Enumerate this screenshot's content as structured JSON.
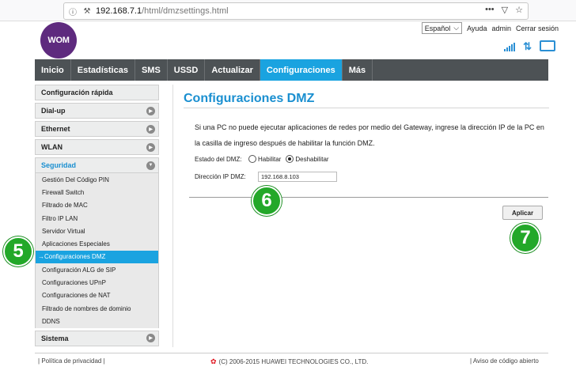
{
  "browser": {
    "url_host": "192.168.7.1",
    "url_path": "/html/dmzsettings.html",
    "menu_glyph": "•••"
  },
  "header": {
    "logo_text": "WOM",
    "language": "Español",
    "help": "Ayuda",
    "user": "admin",
    "logout": "Cerrar sesión"
  },
  "nav": {
    "items": [
      "Inicio",
      "Estadísticas",
      "SMS",
      "USSD",
      "Actualizar",
      "Configuraciones",
      "Más"
    ],
    "active_index": 5
  },
  "sidebar": {
    "quick": "Configuración rápida",
    "dialup": "Dial-up",
    "ethernet": "Ethernet",
    "wlan": "WLAN",
    "security": "Seguridad",
    "security_items": [
      "Gestión Del Código PIN",
      "Firewall Switch",
      "Filtrado de MAC",
      "Filtro IP LAN",
      "Servidor Virtual",
      "Aplicaciones Especiales",
      "→Configuraciones DMZ",
      "Configuración ALG de SIP",
      "Configuraciones UPnP",
      "Configuraciones de NAT",
      "Filtrado de nombres de dominio",
      "DDNS"
    ],
    "system": "Sistema"
  },
  "main": {
    "title": "Configuraciones DMZ",
    "description": "Si una PC no puede ejecutar aplicaciones de redes por medio del Gateway, ingrese la dirección IP de la PC en la casilla de ingreso después de habilitar la función DMZ.",
    "dmz_state_label": "Estado del DMZ:",
    "enable_label": "Habilitar",
    "disable_label": "Deshabilitar",
    "selected": "Deshabilitar",
    "ip_label": "Dirección IP DMZ:",
    "ip_value": "192.168.8.103",
    "apply_label": "Aplicar"
  },
  "badges": {
    "b5": "5",
    "b6": "6",
    "b7": "7"
  },
  "footer": {
    "privacy": "Política de privacidad",
    "copyright": "(C) 2006-2015 HUAWEI TECHNOLOGIES CO., LTD.",
    "opensource": "Aviso de código abierto"
  },
  "colors": {
    "accent": "#1aa3e0",
    "nav_bg": "#4d5255",
    "logo": "#5e2a7e",
    "badge": "#23a829"
  }
}
